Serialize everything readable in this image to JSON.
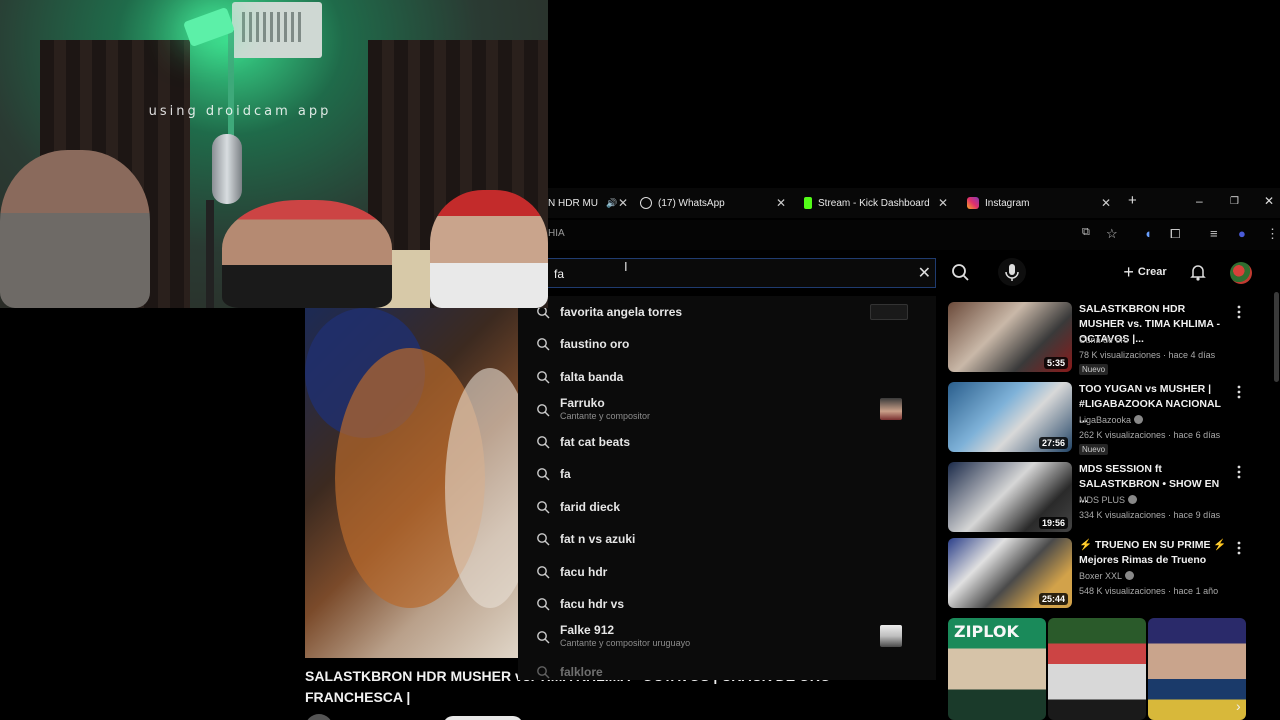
{
  "webcam": {
    "watermark": "using droidcam app"
  },
  "tabs": [
    {
      "label": "N HDR MU",
      "favicon": "youtube-icon",
      "active": true
    },
    {
      "label": "(17) WhatsApp",
      "favicon": "whatsapp-icon"
    },
    {
      "label": "Stream - Kick Dashboard",
      "favicon": "kick-icon"
    },
    {
      "label": "Instagram",
      "favicon": "instagram-icon"
    }
  ],
  "address": {
    "url": "HIA"
  },
  "search": {
    "value": "fa",
    "create_label": "Crear"
  },
  "suggestions": [
    {
      "text": "favorita angela torres",
      "thumb": "wide"
    },
    {
      "text": "faustino oro"
    },
    {
      "text": "falta banda"
    },
    {
      "text": "Farruko",
      "sub": "Cantante y compositor",
      "thumb": "person"
    },
    {
      "text": "fat cat beats"
    },
    {
      "text": "fa"
    },
    {
      "text": "farid dieck"
    },
    {
      "text": "fat n vs azuki"
    },
    {
      "text": "facu hdr"
    },
    {
      "text": "facu hdr vs"
    },
    {
      "text": "Falke 912",
      "sub": "Cantante y compositor uruguayo",
      "thumb": "person"
    },
    {
      "text": "falklore"
    }
  ],
  "main_video": {
    "title_line1": "SALASTKBRON HDR MUSHER vs. TIMA KHLIMA - OCTAVOS | CRACK DE ORO",
    "title_line2": "FRANCHESCA |"
  },
  "recommended": [
    {
      "title": "SALASTKBRON HDR MUSHER vs. TIMA KHLIMA - OCTAVOS |...",
      "channel": "Cuna de oro",
      "verified": false,
      "meta": "78 K visualizaciones · hace 4 días",
      "badge": "Nuevo",
      "duration": "5:35"
    },
    {
      "title": "TOO YUGAN vs MUSHER | #LIGABAZOOKA NACIONAL ...",
      "channel": "LigaBazooka",
      "verified": true,
      "meta": "262 K visualizaciones · hace 6 días",
      "badge": "Nuevo",
      "duration": "27:56"
    },
    {
      "title": "MDS SESSION ft SALASTKBRON • SHOW EN ...",
      "channel": "MDS PLUS",
      "verified": true,
      "meta": "334 K visualizaciones · hace 9 días",
      "badge": "",
      "duration": "19:56"
    },
    {
      "title": "⚡ TRUENO EN SU PRIME ⚡ Mejores Rimas de Trueno",
      "channel": "Boxer XXL",
      "verified": true,
      "meta": "548 K visualizaciones · hace 1 año",
      "badge": "",
      "duration": "25:44"
    }
  ],
  "shorts": [
    {
      "label": "ZIPLOK"
    },
    {
      "label": ""
    },
    {
      "label": ""
    }
  ],
  "colors": {
    "accent": "#3ea6ff",
    "bg": "#0f0f0f",
    "webcam_green": "#39d98a"
  }
}
